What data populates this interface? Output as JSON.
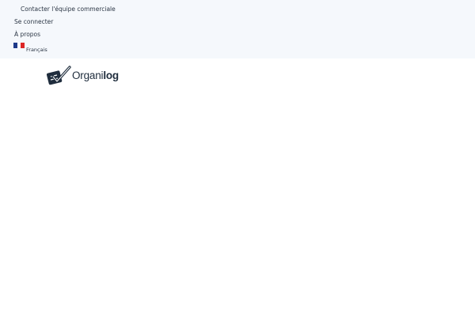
{
  "topbar": {
    "contact_sales": "Contacter l'équipe commerciale",
    "login": "Se connecter",
    "about": "À propos",
    "language": {
      "label": "Français",
      "flag_colors": [
        "#1e3a8a",
        "#ffffff",
        "#dc2626"
      ]
    }
  },
  "brand": {
    "name_light": "Organi",
    "name_bold": "log",
    "logo_color": "#1f2d3d"
  }
}
